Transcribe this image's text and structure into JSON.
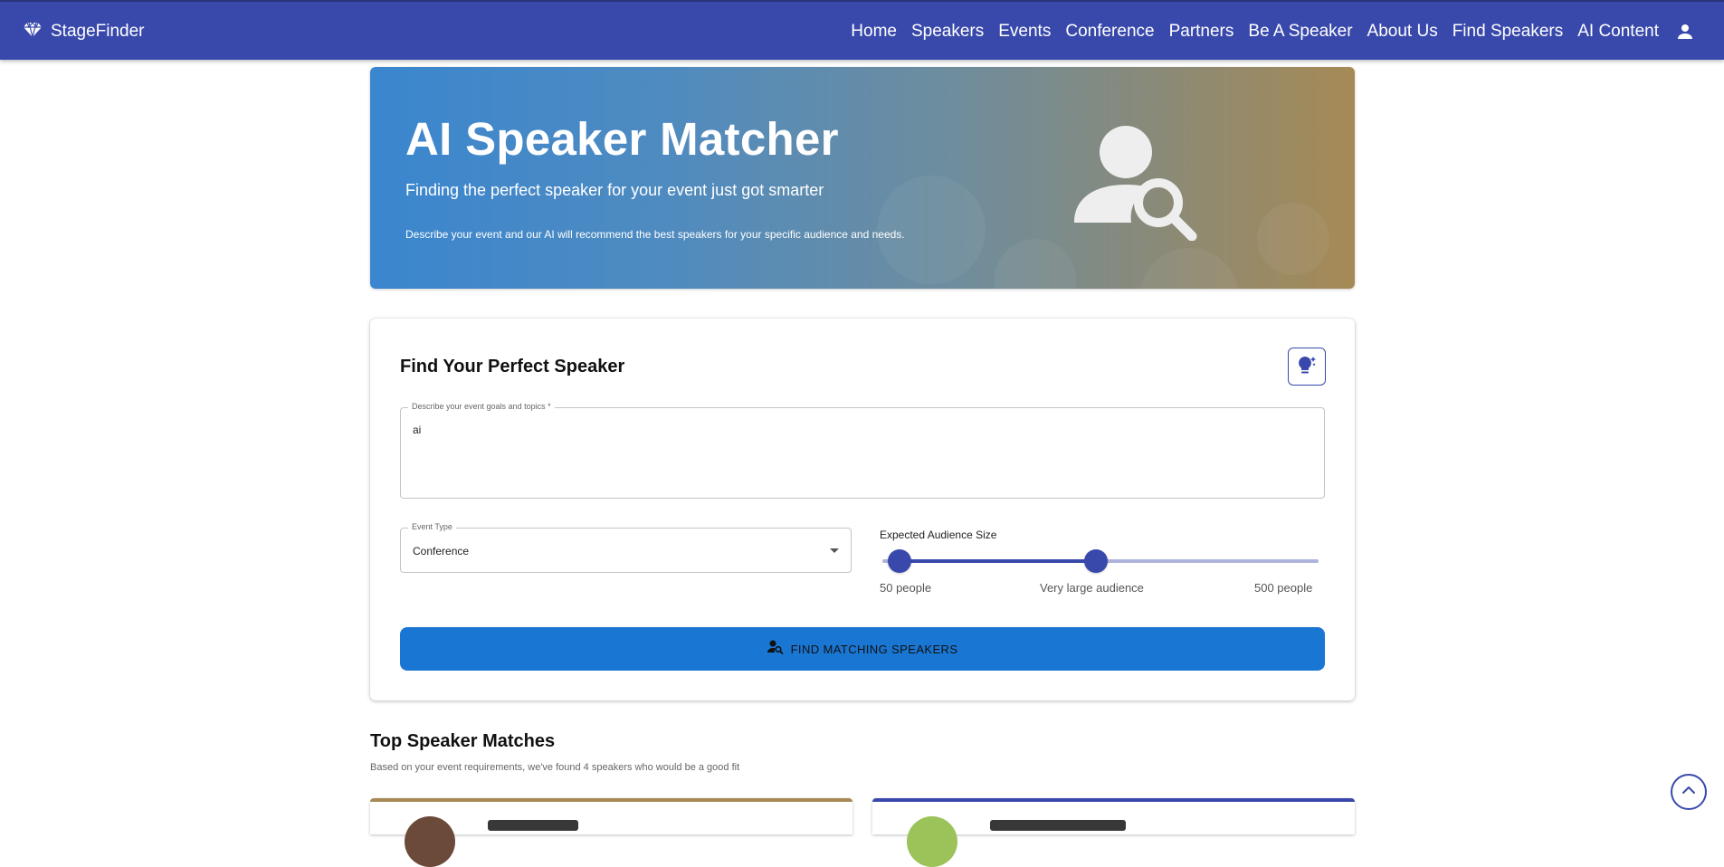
{
  "app": {
    "brand_name": "StageFinder",
    "brand_icon": "diamond-icon"
  },
  "nav": {
    "items": [
      "Home",
      "Speakers",
      "Events",
      "Conference",
      "Partners",
      "Be A Speaker",
      "About Us",
      "Find Speakers",
      "AI Content"
    ],
    "account_icon": "person-icon"
  },
  "hero": {
    "title": "AI Speaker Matcher",
    "subtitle": "Finding the perfect speaker for your event just got smarter",
    "description": "Describe your event and our AI will recommend the best speakers for your specific audience and needs.",
    "icon": "person-search-icon"
  },
  "form": {
    "title": "Find Your Perfect Speaker",
    "ai_suggest_icon": "lightbulb-sparkle-icon",
    "goals": {
      "label": "Describe your event goals and topics *",
      "value": "ai"
    },
    "event_type": {
      "label": "Event Type",
      "value": "Conference"
    },
    "audience": {
      "label": "Expected Audience Size",
      "range_low_fraction": 0.04,
      "range_high_fraction": 0.49,
      "marks": [
        "50 people",
        "Very large audience",
        "500 people"
      ]
    },
    "submit": {
      "label": "FIND MATCHING SPEAKERS",
      "icon": "person-search-icon"
    }
  },
  "results": {
    "title": "Top Speaker Matches",
    "description": "Based on your event requirements, we've found 4 speakers who would be a good fit"
  },
  "colors": {
    "primary": "#3949ab",
    "button": "#1976d2",
    "accent_gold": "#a68a55"
  },
  "scroll_top_icon": "chevron-up-icon"
}
